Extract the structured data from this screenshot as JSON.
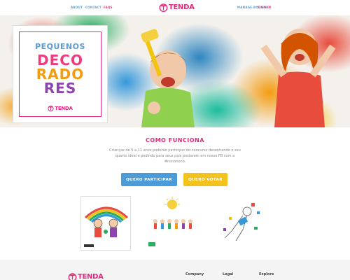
{
  "nav": {
    "left_links": [
      "ABOUT",
      "CONTACT",
      "FAQS"
    ],
    "right_links": [
      "MANAGE BOOKING",
      "SIGN IN"
    ]
  },
  "brand": {
    "name": "TENDA",
    "color": "#e6297a",
    "icon": "paint-roller-icon"
  },
  "hero": {
    "card": {
      "line1": "PEQUENOS",
      "line2": "DECO",
      "line3": "RADO",
      "line4": "RES",
      "brand": "TENDA"
    }
  },
  "section": {
    "title": "COMO FUNCIONA",
    "text": "Crianças de 5 a 11 anos poderão participar do concurso desenhando o seu quarto ideal e pedindo para seus pais postarem em nosso FB com a #nononono.",
    "buttons": {
      "participar": "QUERO PARTICIPAR",
      "votar": "QUERO VOTAR"
    }
  },
  "drawings": [
    {
      "caption": ""
    },
    {
      "caption": ""
    },
    {
      "caption": ""
    }
  ],
  "footer": {
    "brand": "TENDA",
    "columns": [
      "Company",
      "Legal",
      "Explore"
    ]
  },
  "colors": {
    "primary_blue": "#4a9bd8",
    "primary_yellow": "#f4c21c",
    "accent_pink": "#e6297a"
  }
}
